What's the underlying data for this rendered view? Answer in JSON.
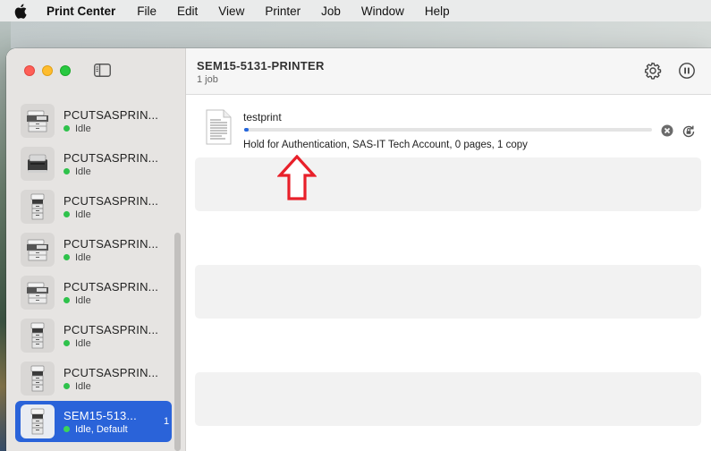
{
  "menubar": {
    "apple": "apple-icon",
    "items": [
      {
        "label": "Print Center",
        "app": true
      },
      {
        "label": "File"
      },
      {
        "label": "Edit"
      },
      {
        "label": "View"
      },
      {
        "label": "Printer"
      },
      {
        "label": "Job"
      },
      {
        "label": "Window"
      },
      {
        "label": "Help"
      }
    ]
  },
  "sidebar": {
    "printers": [
      {
        "name": "PCUTSASPRIN...",
        "status": "Idle",
        "kind": "mfp-white"
      },
      {
        "name": "PCUTSASPRIN...",
        "status": "Idle",
        "kind": "laser-dark"
      },
      {
        "name": "PCUTSASPRIN...",
        "status": "Idle",
        "kind": "tower"
      },
      {
        "name": "PCUTSASPRIN...",
        "status": "Idle",
        "kind": "mfp-white"
      },
      {
        "name": "PCUTSASPRIN...",
        "status": "Idle",
        "kind": "mfp-white"
      },
      {
        "name": "PCUTSASPRIN...",
        "status": "Idle",
        "kind": "tower"
      },
      {
        "name": "PCUTSASPRIN...",
        "status": "Idle",
        "kind": "tower"
      },
      {
        "name": "SEM15-513...",
        "status": "Idle, Default",
        "kind": "tower",
        "selected": true,
        "jobs": "1"
      }
    ]
  },
  "main": {
    "printer_title": "SEM15-5131-PRINTER",
    "job_count": "1 job",
    "job": {
      "name": "testprint",
      "progress": 0.01,
      "status": "Hold for Authentication, SAS-IT Tech Account, 0 pages, 1 copy"
    }
  },
  "colors": {
    "accent": "#2a63d9",
    "status_idle": "#2ec24b",
    "annotation_arrow": "#e8202a"
  }
}
